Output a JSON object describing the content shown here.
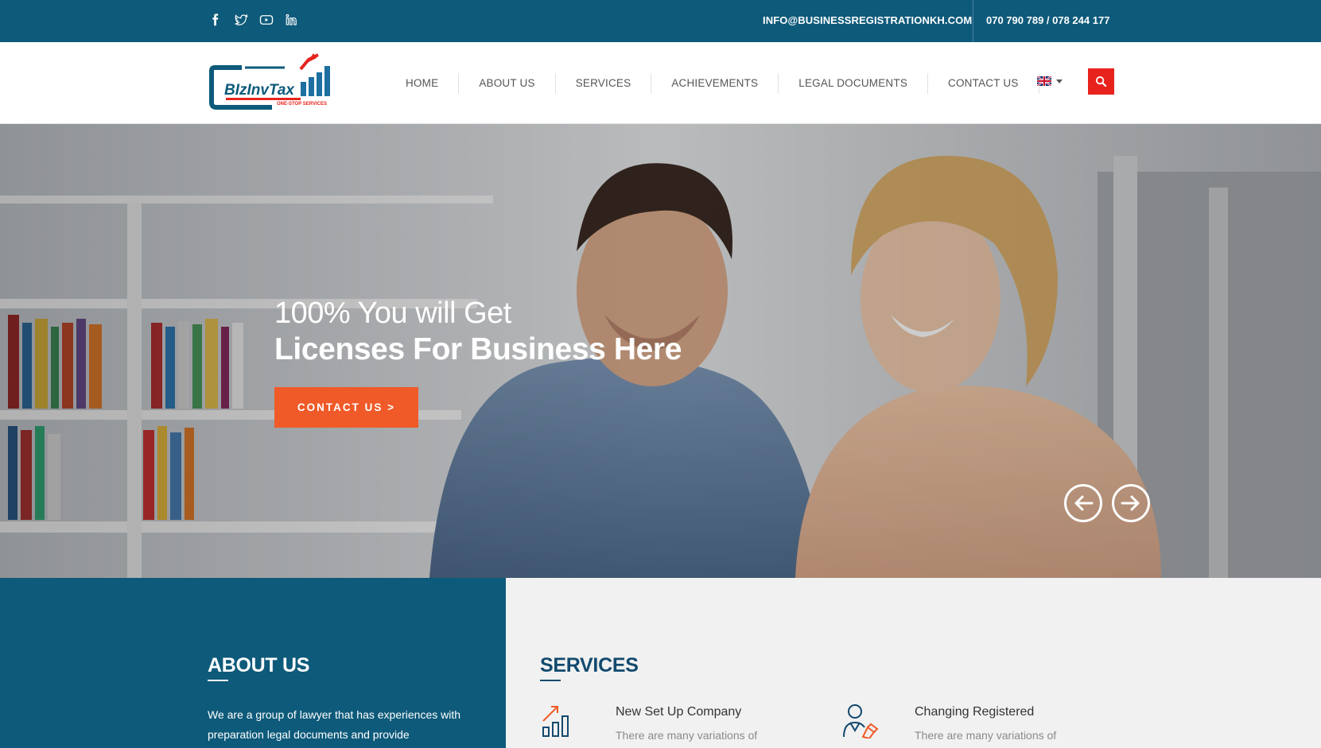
{
  "topbar": {
    "social": [
      "facebook-icon",
      "twitter-icon",
      "youtube-icon",
      "linkedin-icon"
    ],
    "email": "INFO@BUSINESSREGISTRATIONKH.COM",
    "phone": "070 790 789 / 078 244 177"
  },
  "header": {
    "logo_text": "BIzInvTax",
    "logo_tagline": "ONE-STOP SERVICES",
    "nav": [
      "HOME",
      "ABOUT US",
      "SERVICES",
      "ACHIEVEMENTS",
      "LEGAL DOCUMENTS",
      "CONTACT US"
    ],
    "language_icon": "uk-flag-icon"
  },
  "hero": {
    "line1": "100% You will Get",
    "line2": "Licenses For Business Here",
    "cta": "CONTACT US >"
  },
  "about": {
    "title": "ABOUT US",
    "text": "We are a group of lawyer that has experiences with preparation legal documents and provide"
  },
  "services": {
    "title": "SERVICES",
    "items": [
      {
        "title": "New Set Up Company",
        "desc": "There are many variations of",
        "icon": "bar-chart-icon"
      },
      {
        "title": "Changing Registered",
        "desc": "There are many variations of",
        "icon": "user-edit-icon"
      }
    ]
  },
  "colors": {
    "brand_blue": "#0e5a7a",
    "accent_orange": "#f05a28",
    "search_red": "#e8231d"
  }
}
